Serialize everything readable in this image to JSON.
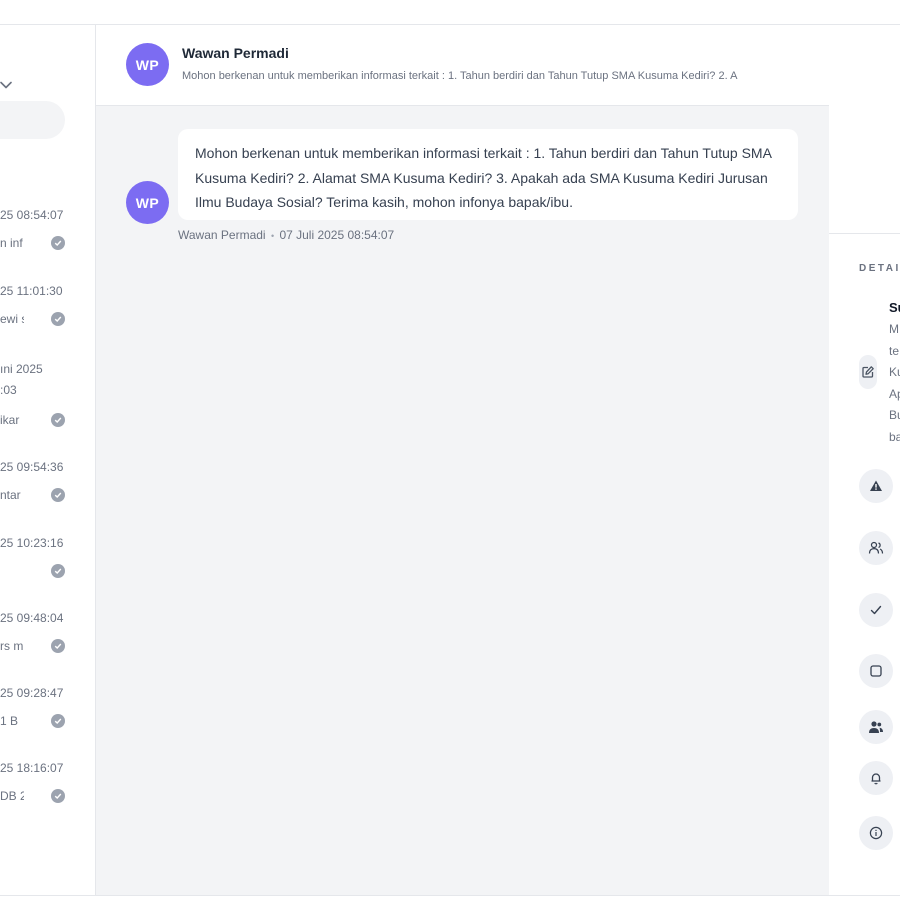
{
  "conversation": {
    "contact_name": "Wawan Permadi",
    "avatar_initials": "WP",
    "header_snippet": "Mohon berkenan untuk memberikan informasi terkait : 1. Tahun berdiri dan Tahun Tutup SMA Kusuma Kediri? 2. A",
    "message_text": "Mohon berkenan untuk memberikan informasi terkait : 1. Tahun berdiri dan Tahun Tutup SMA Kusuma Kediri? 2. Alamat SMA Kusuma Kediri? 3. Apakah ada SMA Kusuma Kediri Jurusan Ilmu Budaya Sosial? Terima kasih, mohon infonya bapak/ibu.",
    "message_sender": "Wawan Permadi",
    "message_separator": "•",
    "message_time": "07 Juli 2025 08:54:07"
  },
  "conversation_list": [
    {
      "date": "25 08:54:07",
      "snippet": "n inf"
    },
    {
      "date": "25 11:01:30",
      "snippet": "ewi s"
    },
    {
      "date_line1": "ıni 2025",
      "date_line2": ":03",
      "snippet": "ikar"
    },
    {
      "date": "25 09:54:36",
      "snippet": "ntar"
    },
    {
      "date": "25 10:23:16",
      "snippet": ""
    },
    {
      "date": "25 09:48:04",
      "snippet": "rs m"
    },
    {
      "date": "25 09:28:47",
      "snippet": "1 B"
    },
    {
      "date": "25 18:16:07",
      "snippet": "DB 2"
    }
  ],
  "details": {
    "section_label": "DETAI",
    "subject_title": "Su",
    "subject_lines": [
      "M",
      "te",
      "Ku",
      "Ap",
      "Bu",
      "ba"
    ]
  },
  "icons": {
    "edit": "edit-icon",
    "warning": "warning-icon",
    "users": "users-icon",
    "check": "check-icon",
    "square": "square-icon",
    "group": "group-icon",
    "bell": "bell-icon",
    "info": "info-icon"
  }
}
